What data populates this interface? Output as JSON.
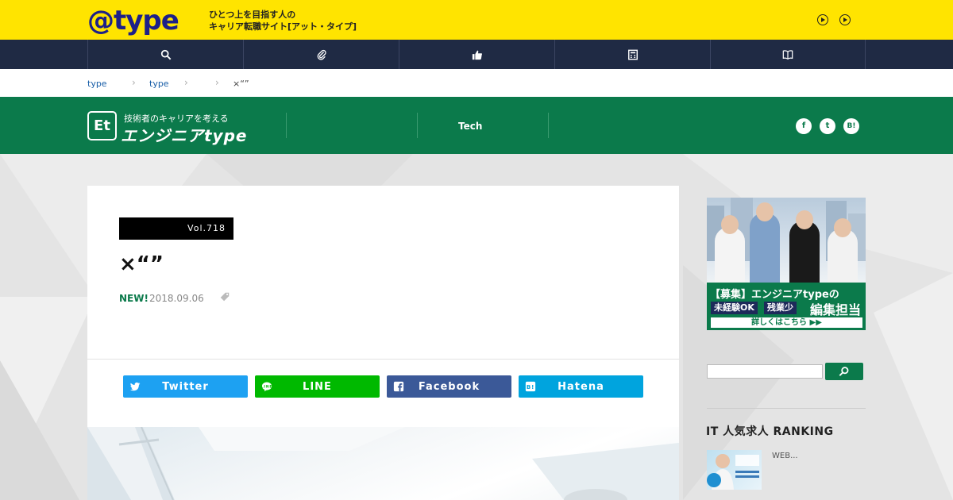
{
  "topbar": {
    "logo": "@type",
    "tagline_line1": "ひとつ上を目指す人の",
    "tagline_line2": "キャリア転職サイト[アット・タイプ]",
    "icons": [
      "play-circle-icon",
      "play-circle-icon"
    ]
  },
  "darknav": {
    "items": [
      {
        "icon": "search-icon"
      },
      {
        "icon": "paperclip-icon"
      },
      {
        "icon": "thumbs-up-icon"
      },
      {
        "icon": "calculator-icon"
      },
      {
        "icon": "open-book-icon"
      }
    ]
  },
  "breadcrumb": {
    "items": [
      "type",
      "type",
      ""
    ],
    "current": "×“”"
  },
  "site_header": {
    "logo_mark": "Et",
    "logo_sub": "技術者のキャリアを考える",
    "logo_main": "エンジニアtype",
    "nav": [
      "",
      "Tech",
      ""
    ],
    "social": [
      "f",
      "t",
      "B!"
    ]
  },
  "article": {
    "vol": "Vol.718",
    "title": "×“”",
    "new_label": "NEW!",
    "date": "2018.09.06",
    "share_buttons": [
      {
        "label": "Twitter",
        "color": "#1da1f2",
        "icon": "twitter-icon"
      },
      {
        "label": "LINE",
        "color": "#00b900",
        "icon": "line-icon"
      },
      {
        "label": "Facebook",
        "color": "#3b5998",
        "icon": "facebook-icon"
      },
      {
        "label": "Hatena",
        "color": "#00a4de",
        "icon": "hatena-icon"
      }
    ]
  },
  "sidebar": {
    "ad": {
      "line1": "【募集】エンジニアtypeの",
      "pill1": "未経験OK",
      "pill2": "残業少",
      "big": "編集担当",
      "bottom": "詳しくはこちら ▶▶"
    },
    "search_placeholder": "",
    "ranking_title": "IT 人気求人 RANKING",
    "ranking_items": [
      {
        "text": "WEB..."
      }
    ]
  },
  "colors": {
    "yellow": "#ffe400",
    "navy": "#1f2a44",
    "green": "#0b7a4b",
    "brand_blue": "#1d2088"
  }
}
